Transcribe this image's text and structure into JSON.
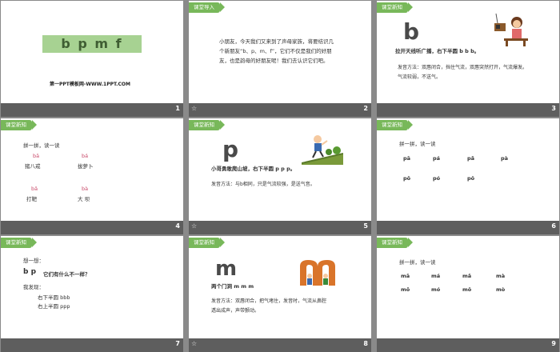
{
  "title_slide": {
    "letters": "b p m f",
    "footer": "第一PPT模板网-WWW.1PPT.COM"
  },
  "numbers": [
    "1",
    "2",
    "3",
    "4",
    "5",
    "6",
    "7",
    "8",
    "9"
  ],
  "badges": {
    "intro": "课堂导入",
    "new": "课堂新知"
  },
  "slide2": {
    "paragraph": [
      "小朋友，今天我们又来到了声母家族，将要结识几",
      "个新朋友“b、p、m、f”，它们不仅是我们的好朋",
      "友，也是韵母的好朋友呢！我们去认识它们吧。"
    ]
  },
  "slide3": {
    "letter": "b",
    "caption": "拉开天线听广播，右下半圆 b b b。",
    "method": [
      "发音方法：双唇闭合，挡住气流，双唇突然打开，气流爆发。",
      "气流较弱，不送气。"
    ]
  },
  "slide4": {
    "heading": "拼一拼，读一读",
    "items": [
      {
        "pinyin": "bā",
        "word": "猪八戒"
      },
      {
        "pinyin": "bá",
        "word": "拔萝卜"
      },
      {
        "pinyin": "bǎ",
        "word": "打靶"
      },
      {
        "pinyin": "bà",
        "word": "大 坝"
      }
    ]
  },
  "slide5": {
    "letter": "p",
    "caption": "小哥勇敢爬山坡，右下半圆 p p p。",
    "method": "发音方法：与b相同，只是气流较强，是送气音。"
  },
  "slide6": {
    "heading": "拼一拼，读一读",
    "row1": [
      "pā",
      "pá",
      "pǎ",
      "pà"
    ],
    "row2": [
      "pō",
      "pó",
      "pǒ"
    ]
  },
  "slide7": {
    "think": "想一想：",
    "question_letters": "b  p",
    "question": "它们有什么不一样？",
    "found": "我发现：",
    "lines": [
      "右下半圆  bbb",
      "右上半圆  ppp"
    ]
  },
  "slide8": {
    "letter": "m",
    "caption": "两个门洞 m m m",
    "method": [
      "发音方法：双唇闭合，把气堵住，发音时，气流从鼻腔",
      "透出成声，声带颤动。"
    ]
  },
  "slide9": {
    "heading": "拼一拼，读一读",
    "row1": [
      "mā",
      "má",
      "mǎ",
      "mà"
    ],
    "row2": [
      "mō",
      "mó",
      "mǒ",
      "mò"
    ]
  },
  "colors": {
    "accent_green": "#78b85a",
    "title_box": "#a7d292",
    "bar": "#5e5e5e",
    "background": "#8a8a8a"
  }
}
